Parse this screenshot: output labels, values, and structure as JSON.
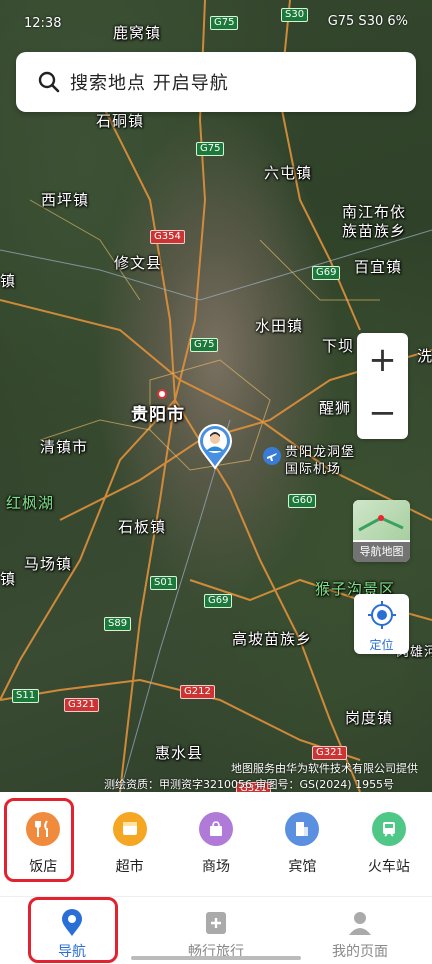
{
  "status": {
    "time": "12:38",
    "right": "G75  S30  6%"
  },
  "search": {
    "placeholder": "搜索地点 开启导航"
  },
  "map": {
    "places": [
      {
        "name": "鹿窝镇"
      },
      {
        "name": "石硐镇"
      },
      {
        "name": "六屯镇"
      },
      {
        "name": "西坪镇"
      },
      {
        "name": "南江布依"
      },
      {
        "name": "族苗族乡"
      },
      {
        "name": "修文县"
      },
      {
        "name": "百宜镇"
      },
      {
        "name": "镇"
      },
      {
        "name": "水田镇"
      },
      {
        "name": "下坝"
      },
      {
        "name": "洗"
      },
      {
        "name": "贵阳市"
      },
      {
        "name": "醒狮"
      },
      {
        "name": "清镇市"
      },
      {
        "name": "贵阳龙洞堡"
      },
      {
        "name": "国际机场"
      },
      {
        "name": "红枫湖"
      },
      {
        "name": "石板镇"
      },
      {
        "name": "马场镇"
      },
      {
        "name": "猴子沟景区"
      },
      {
        "name": "高坡苗族乡"
      },
      {
        "name": "岗雄河"
      },
      {
        "name": "岗度镇"
      },
      {
        "name": "惠水县"
      },
      {
        "name": "镇"
      }
    ],
    "shields": [
      "G75",
      "S30",
      "G75",
      "G354",
      "G69",
      "G75",
      "G60",
      "S01",
      "G69",
      "S89",
      "S11",
      "G321",
      "G212",
      "G321",
      "G321"
    ],
    "zoom_in": "+",
    "zoom_out": "−",
    "nav_map_label": "导航地图",
    "locate_label": "定位",
    "attribution_1": "地图服务由华为软件技术有限公司提供",
    "attribution_2": "测绘资质：甲测资字3210056   审图号：GS(2024) 1955号"
  },
  "categories": [
    {
      "label": "饭店",
      "color": "#f08a3c",
      "icon": "restaurant-icon"
    },
    {
      "label": "超市",
      "color": "#f5a623",
      "icon": "supermarket-icon"
    },
    {
      "label": "商场",
      "color": "#b07ad8",
      "icon": "mall-icon"
    },
    {
      "label": "宾馆",
      "color": "#5b8fe0",
      "icon": "hotel-icon"
    },
    {
      "label": "火车站",
      "color": "#4fc887",
      "icon": "train-icon"
    }
  ],
  "bottom_nav": [
    {
      "label": "导航",
      "active": true
    },
    {
      "label": "畅行旅行",
      "active": false
    },
    {
      "label": "我的页面",
      "active": false
    }
  ]
}
